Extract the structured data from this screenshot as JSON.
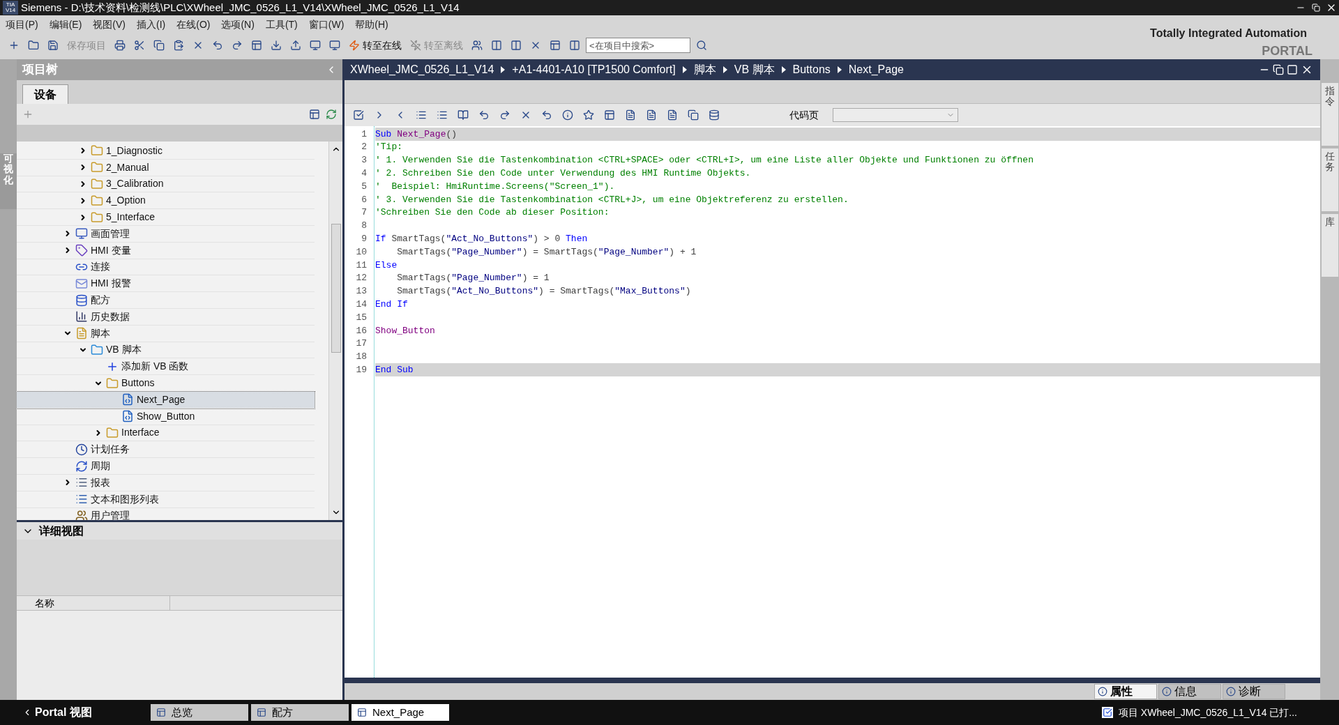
{
  "window": {
    "logo_top": "TIA",
    "logo_bottom": "V14",
    "title": "Siemens  -  D:\\技术资料\\检测线\\PLC\\XWheel_JMC_0526_L1_V14\\XWheel_JMC_0526_L1_V14"
  },
  "menu": [
    "项目(P)",
    "编辑(E)",
    "视图(V)",
    "插入(I)",
    "在线(O)",
    "选项(N)",
    "工具(T)",
    "窗口(W)",
    "帮助(H)"
  ],
  "toolbar": {
    "save_label": "保存项目",
    "save_disabled": true,
    "online_label": "转至在线",
    "online_disabled": false,
    "offline_label": "转至离线",
    "offline_disabled": true,
    "search_placeholder": "<在项目中搜索>"
  },
  "brand": {
    "line1": "Totally Integrated Automation",
    "line2": "PORTAL"
  },
  "left_strip": {
    "label": "可视化"
  },
  "project_tree": {
    "title": "项目树",
    "tab": "设备",
    "continued_items": [
      {
        "label": "1_Diagnostic",
        "kind": "folder",
        "expanded": false,
        "selected": false
      },
      {
        "label": "2_Manual",
        "kind": "folder",
        "expanded": false,
        "selected": false
      },
      {
        "label": "3_Calibration",
        "kind": "folder",
        "expanded": false,
        "selected": false
      },
      {
        "label": "4_Option",
        "kind": "folder",
        "expanded": false,
        "selected": false
      },
      {
        "label": "5_Interface",
        "kind": "folder",
        "expanded": false,
        "selected": false
      }
    ],
    "items": [
      {
        "label": "画面管理",
        "kind": "screens",
        "expanded": false,
        "selected": false
      },
      {
        "label": "HMI 变量",
        "kind": "tags",
        "expanded": false,
        "selected": false
      },
      {
        "label": "连接",
        "kind": "connections",
        "selected": false
      },
      {
        "label": "HMI 报警",
        "kind": "alarms",
        "selected": false
      },
      {
        "label": "配方",
        "kind": "recipes",
        "selected": false
      },
      {
        "label": "历史数据",
        "kind": "history",
        "selected": false
      },
      {
        "label": "脚本",
        "kind": "scripts",
        "expanded": true,
        "selected": false,
        "children": [
          {
            "label": "VB 脚本",
            "kind": "vbfolder",
            "expanded": true,
            "selected": false,
            "children": [
              {
                "label": "添加新 VB 函数",
                "kind": "add",
                "selected": false
              },
              {
                "label": "Buttons",
                "kind": "folder",
                "expanded": true,
                "selected": false,
                "children": [
                  {
                    "label": "Next_Page",
                    "kind": "script",
                    "selected": true
                  },
                  {
                    "label": "Show_Button",
                    "kind": "script",
                    "selected": false
                  }
                ]
              },
              {
                "label": "Interface",
                "kind": "folder",
                "expanded": false,
                "selected": false
              }
            ]
          }
        ]
      },
      {
        "label": "计划任务",
        "kind": "tasks",
        "selected": false
      },
      {
        "label": "周期",
        "kind": "cycles",
        "selected": false
      },
      {
        "label": "报表",
        "kind": "reports",
        "expanded": false,
        "selected": false
      },
      {
        "label": "文本和图形列表",
        "kind": "textlists",
        "selected": false
      },
      {
        "label": "用户管理",
        "kind": "users",
        "selected": false
      }
    ]
  },
  "detail_view": {
    "title": "详细视图",
    "column": "名称"
  },
  "editor": {
    "breadcrumb": [
      "XWheel_JMC_0526_L1_V14",
      "+A1-4401-A10 [TP1500 Comfort]",
      "脚本",
      "VB 脚本",
      "Buttons",
      "Next_Page"
    ],
    "codepage_label": "代码页",
    "lines": [
      {
        "number": "1",
        "highlighted": true,
        "segments": [
          {
            "kind": "keyword",
            "text": "Sub "
          },
          {
            "kind": "name",
            "text": "Next_Page"
          },
          {
            "kind": "plain",
            "text": "()"
          }
        ]
      },
      {
        "number": "2",
        "highlighted": false,
        "segments": [
          {
            "kind": "comment",
            "text": "'Tip:"
          }
        ]
      },
      {
        "number": "3",
        "highlighted": false,
        "segments": [
          {
            "kind": "comment",
            "text": "' 1. Verwenden Sie die Tastenkombination <CTRL+SPACE> oder <CTRL+I>, um eine Liste aller Objekte und Funktionen zu öffnen"
          }
        ]
      },
      {
        "number": "4",
        "highlighted": false,
        "segments": [
          {
            "kind": "comment",
            "text": "' 2. Schreiben Sie den Code unter Verwendung des HMI Runtime Objekts."
          }
        ]
      },
      {
        "number": "5",
        "highlighted": false,
        "segments": [
          {
            "kind": "comment",
            "text": "'  Beispiel: HmiRuntime.Screens(\"Screen_1\")."
          }
        ]
      },
      {
        "number": "6",
        "highlighted": false,
        "segments": [
          {
            "kind": "comment",
            "text": "' 3. Verwenden Sie die Tastenkombination <CTRL+J>, um eine Objektreferenz zu erstellen."
          }
        ]
      },
      {
        "number": "7",
        "highlighted": false,
        "segments": [
          {
            "kind": "comment",
            "text": "'Schreiben Sie den Code ab dieser Position:"
          }
        ]
      },
      {
        "number": "8",
        "highlighted": false
      },
      {
        "number": "9",
        "highlighted": false,
        "segments": [
          {
            "kind": "keyword",
            "text": "If "
          },
          {
            "kind": "plain",
            "text": "SmartTags("
          },
          {
            "kind": "string",
            "text": "\"Act_No_Buttons\""
          },
          {
            "kind": "plain",
            "text": ") > 0 "
          },
          {
            "kind": "keyword",
            "text": "Then"
          }
        ]
      },
      {
        "number": "10",
        "highlighted": false,
        "segments": [
          {
            "kind": "plain",
            "text": "    SmartTags("
          },
          {
            "kind": "string",
            "text": "\"Page_Number\""
          },
          {
            "kind": "plain",
            "text": ") = SmartTags("
          },
          {
            "kind": "string",
            "text": "\"Page_Number\""
          },
          {
            "kind": "plain",
            "text": ") + 1"
          }
        ]
      },
      {
        "number": "11",
        "highlighted": false,
        "segments": [
          {
            "kind": "keyword",
            "text": "Else"
          }
        ]
      },
      {
        "number": "12",
        "highlighted": false,
        "segments": [
          {
            "kind": "plain",
            "text": "    SmartTags("
          },
          {
            "kind": "string",
            "text": "\"Page_Number\""
          },
          {
            "kind": "plain",
            "text": ") = 1"
          }
        ]
      },
      {
        "number": "13",
        "highlighted": false,
        "segments": [
          {
            "kind": "plain",
            "text": "    SmartTags("
          },
          {
            "kind": "string",
            "text": "\"Act_No_Buttons\""
          },
          {
            "kind": "plain",
            "text": ") = SmartTags("
          },
          {
            "kind": "string",
            "text": "\"Max_Buttons\""
          },
          {
            "kind": "plain",
            "text": ")"
          }
        ]
      },
      {
        "number": "14",
        "highlighted": false,
        "segments": [
          {
            "kind": "keyword",
            "text": "End If"
          }
        ]
      },
      {
        "number": "15",
        "highlighted": false
      },
      {
        "number": "16",
        "highlighted": false,
        "segments": [
          {
            "kind": "name",
            "text": "Show_Button"
          }
        ]
      },
      {
        "number": "17",
        "highlighted": false
      },
      {
        "number": "18",
        "highlighted": false
      },
      {
        "number": "19",
        "highlighted": true,
        "segments": [
          {
            "kind": "keyword",
            "text": "End Sub"
          }
        ]
      }
    ]
  },
  "right_strip": [
    "指令",
    "任务",
    "库"
  ],
  "inspector_tabs": [
    {
      "label": "属性",
      "selected": true
    },
    {
      "label": "信息",
      "selected": false
    },
    {
      "label": "诊断",
      "selected": false
    }
  ],
  "taskbar": {
    "portal": "Portal 视图",
    "tabs": [
      {
        "label": "总览",
        "selected": false
      },
      {
        "label": "配方",
        "selected": false
      },
      {
        "label": "Next_Page",
        "selected": true
      }
    ],
    "status": "项目 XWheel_JMC_0526_L1_V14 已打..."
  }
}
